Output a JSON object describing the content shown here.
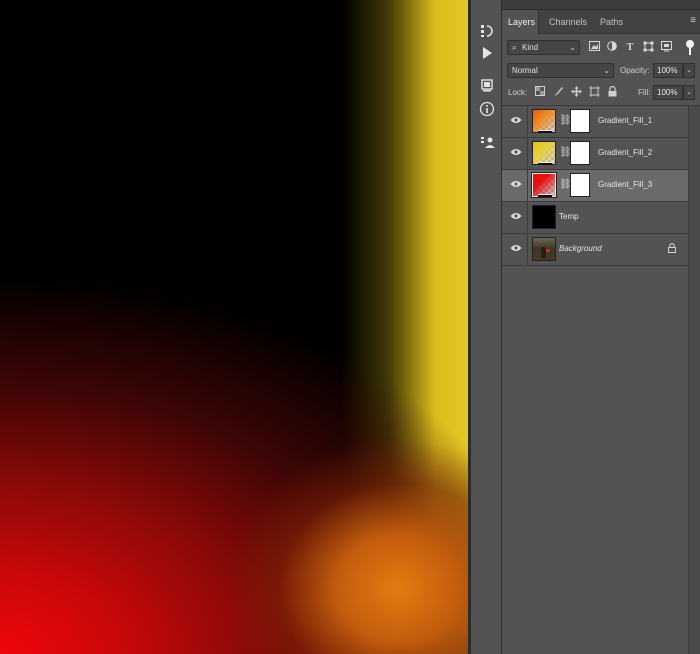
{
  "canvas": {
    "description_colors": {
      "black": "#000000",
      "yellow": "#e3c824",
      "red": "#f0060a",
      "orange": "#e37a10"
    }
  },
  "toolstrip": {
    "collapse_icon": "«",
    "icons": [
      "history-icon",
      "play-actions-icon",
      "3d-icon",
      "info-icon",
      "properties-icon"
    ]
  },
  "panel": {
    "tabs": [
      {
        "label": "Layers",
        "active": true
      },
      {
        "label": "Channels",
        "active": false
      },
      {
        "label": "Paths",
        "active": false
      }
    ],
    "filter": {
      "value": "Kind"
    },
    "blend_mode": {
      "value": "Normal"
    },
    "opacity": {
      "label": "Opacity:",
      "value": "100%"
    },
    "lock": {
      "label": "Lock:"
    },
    "fill": {
      "label": "Fill:",
      "value": "100%"
    },
    "layers": [
      {
        "name": "Gradient_Fill_1",
        "type": "gradient",
        "gradient": "orange",
        "selected": false
      },
      {
        "name": "Gradient_Fill_2",
        "type": "gradient",
        "gradient": "yellow",
        "selected": false
      },
      {
        "name": "Gradient_Fill_3",
        "type": "gradient",
        "gradient": "red",
        "selected": true
      },
      {
        "name": "Temp",
        "type": "solid",
        "selected": false
      },
      {
        "name": "Background",
        "type": "image",
        "locked": true,
        "selected": false
      }
    ]
  }
}
